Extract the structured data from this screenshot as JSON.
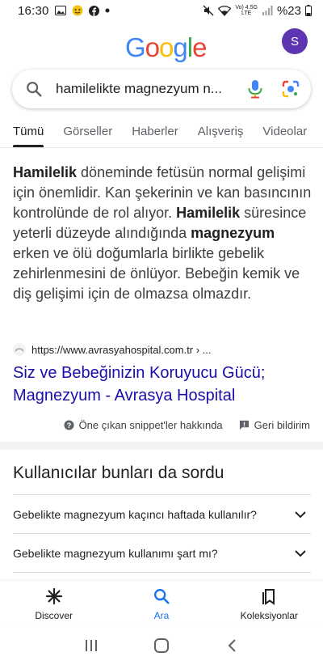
{
  "status_bar": {
    "time": "16:30",
    "network_label": "Vo) 4.5G\nLTE",
    "battery_text": "%23"
  },
  "header": {
    "logo_text": "Google",
    "avatar_letter": "S"
  },
  "search": {
    "query": "hamilelikte magnezyum n..."
  },
  "tabs": [
    {
      "label": "Tümü",
      "active": true
    },
    {
      "label": "Görseller",
      "active": false
    },
    {
      "label": "Haberler",
      "active": false
    },
    {
      "label": "Alışveriş",
      "active": false
    },
    {
      "label": "Videolar",
      "active": false
    }
  ],
  "featured_snippet": {
    "text_parts": [
      {
        "t": "Hamilelik",
        "bold": true
      },
      {
        "t": " döneminde fetüsün normal gelişimi için önemlidir. Kan şekerinin ve kan basıncının kontrolünde de rol alıyor. ",
        "bold": false
      },
      {
        "t": "Hamilelik",
        "bold": true
      },
      {
        "t": " süresince yeterli düzeyde alındığında ",
        "bold": false
      },
      {
        "t": "magnezyum",
        "bold": true
      },
      {
        "t": " erken ve ölü doğumlarla birlikte gebelik zehirlenmesini de önlüyor. Bebeğin kemik ve diş gelişimi için de olmazsa olmazdır.",
        "bold": false
      }
    ],
    "source_url": "https://www.avrasyahospital.com.tr › ...",
    "result_title": "Siz ve Bebeğinizin Koruyucu Gücü; Magnezyum - Avrasya Hospital",
    "about_label": "Öne çıkan snippet'ler hakkında",
    "feedback_label": "Geri bildirim"
  },
  "people_also_ask": {
    "title": "Kullanıcılar bunları da sordu",
    "questions": [
      "Gebelikte magnezyum kaçıncı haftada kullanılır?",
      "Gebelikte magnezyum kullanımı şart mı?"
    ]
  },
  "bottom_nav": {
    "items": [
      {
        "label": "Discover",
        "icon": "asterisk-icon",
        "active": false
      },
      {
        "label": "Ara",
        "icon": "search-icon",
        "active": true
      },
      {
        "label": "Koleksiyonlar",
        "icon": "collections-icon",
        "active": false
      }
    ]
  },
  "colors": {
    "link": "#1a0dab",
    "accent": "#1a73e8",
    "avatar": "#5e35b1"
  }
}
